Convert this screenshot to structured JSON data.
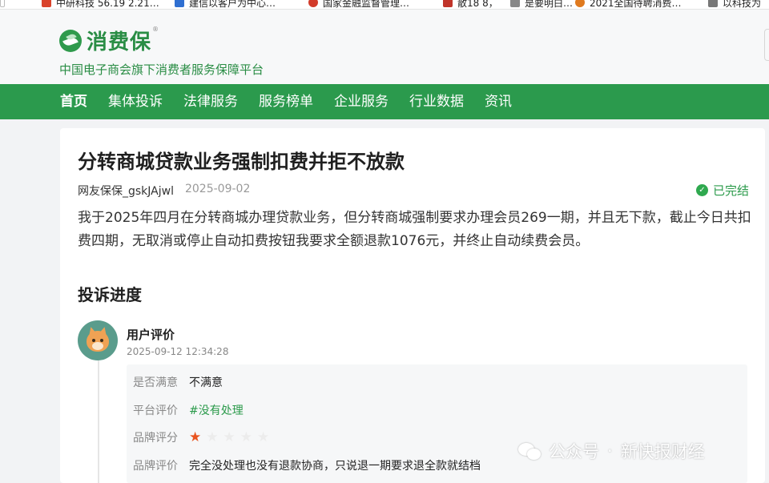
{
  "bookmarks": [
    {
      "label": "中研科技 56.19 2.21…",
      "icon": "red-bookmark-icon",
      "color": "#d9432b"
    },
    {
      "label": "建信以客户为中心…",
      "icon": "blue-bookmark-icon",
      "color": "#2f6fd1"
    },
    {
      "label": "国家金融监督管理…",
      "icon": "emblem-bookmark-icon",
      "color": "#d23b2a"
    },
    {
      "label": "散18 8，",
      "icon": "bank-bookmark-icon",
      "color": "#c0342a"
    },
    {
      "label": "是要明白…",
      "icon": "gray-bookmark-icon",
      "color": "#888888"
    },
    {
      "label": "2021全国待聘消费…",
      "icon": "orange-bookmark-icon",
      "color": "#e07a1e"
    },
    {
      "label": "以科技为",
      "icon": "gray-bookmark-icon",
      "color": "#777777"
    }
  ],
  "header": {
    "logo_text": "消费保",
    "logo_reg": "®",
    "slogan": "中国电子商会旗下消费者服务保障平台"
  },
  "nav": {
    "items": [
      "首页",
      "集体投诉",
      "法律服务",
      "服务榜单",
      "企业服务",
      "行业数据",
      "资讯"
    ],
    "active_index": 0
  },
  "complaint": {
    "title": "分转商城贷款业务强制扣费并拒不放款",
    "user": "网友保保_gskJAjwl",
    "date": "2025-09-02",
    "status": "已完结",
    "content": "我于2025年四月在分转商城办理贷款业务，但分转商城强制要求办理会员269一期，并且无下款，截止今日共扣费四期，无取消或停止自动扣费按钮我要求全额退款1076元，并终止自动续费会员。"
  },
  "progress": {
    "section_title": "投诉进度",
    "evaluation": {
      "title": "用户评价",
      "time": "2025-09-12 12:34:28",
      "satisfied_label": "是否满意",
      "satisfied_value": "不满意",
      "platform_label": "平台评价",
      "platform_value": "#没有处理",
      "brand_score_label": "品牌评分",
      "brand_score": 1,
      "brand_score_max": 5,
      "brand_review_label": "品牌评价",
      "brand_review_value": "完全没处理也没有退款协商，只说退一期要求退全款就结档"
    }
  },
  "watermark": {
    "prefix": "公众号",
    "separator": "·",
    "name": "新快报财经"
  },
  "colors": {
    "brand_green": "#2b9a4d",
    "status_green": "#2a9a4a",
    "star_active": "#e9541f"
  }
}
